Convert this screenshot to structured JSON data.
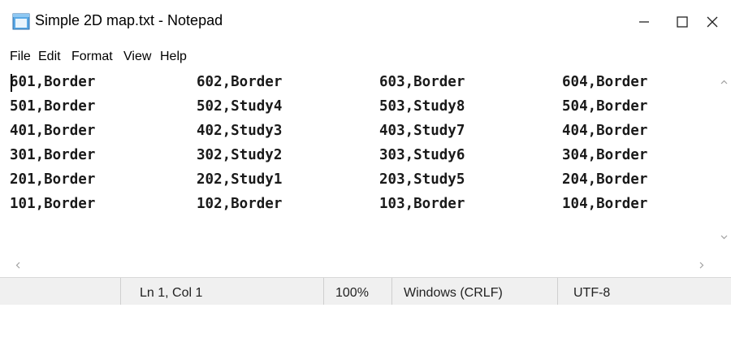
{
  "window": {
    "title": "Simple 2D map.txt - Notepad",
    "controls": {
      "minimize": "—",
      "maximize": "☐",
      "close": "✕"
    }
  },
  "menu": [
    "File",
    "Edit",
    "Format",
    "View",
    "Help"
  ],
  "editor": {
    "lines": [
      [
        "601,Border",
        "602,Border",
        "603,Border",
        "604,Border"
      ],
      [
        "501,Border",
        "502,Study4",
        "503,Study8",
        "504,Border"
      ],
      [
        "401,Border",
        "402,Study3",
        "403,Study7",
        "404,Border"
      ],
      [
        "301,Border",
        "302,Study2",
        "303,Study6",
        "304,Border"
      ],
      [
        "201,Border",
        "202,Study1",
        "203,Study5",
        "204,Border"
      ],
      [
        "101,Border",
        "102,Border",
        "103,Border",
        "104,Border"
      ]
    ]
  },
  "status": {
    "position": "Ln 1, Col 1",
    "zoom": "100%",
    "line_endings": "Windows (CRLF)",
    "encoding": "UTF-8"
  }
}
